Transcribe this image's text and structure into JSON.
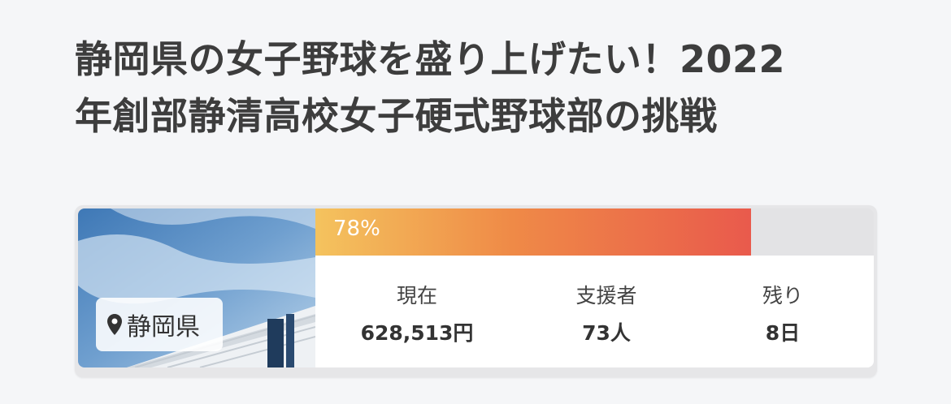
{
  "title": {
    "line1": "静岡県の女子野球を盛り上げたい！2022",
    "line2": "年創部静清高校女子硬式野球部の挑戦"
  },
  "card": {
    "location": "静岡県",
    "progress": {
      "percent": 78,
      "label": "78%",
      "colors": [
        "#f4c35e",
        "#ef8a47",
        "#e95a4c"
      ]
    },
    "stats": [
      {
        "label": "現在",
        "value": "628,513円"
      },
      {
        "label": "支援者",
        "value": "73人"
      },
      {
        "label": "残り",
        "value": "8日"
      }
    ]
  },
  "icons": {
    "location": "map-pin-icon"
  }
}
